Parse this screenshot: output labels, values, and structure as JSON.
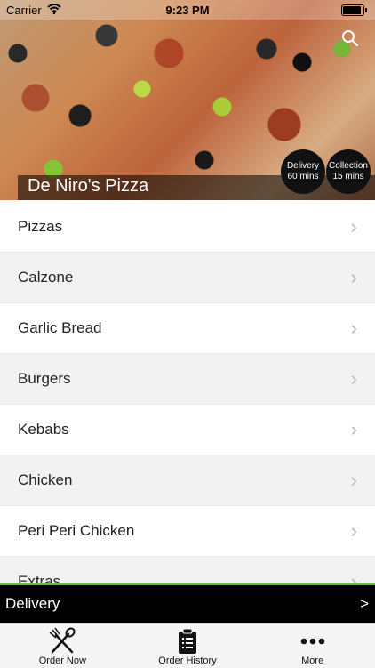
{
  "status_bar": {
    "carrier": "Carrier",
    "time": "9:23 PM"
  },
  "hero": {
    "restaurant_name": "De Niro's Pizza",
    "delivery_badge": {
      "title": "Delivery",
      "time": "60 mins"
    },
    "collection_badge": {
      "title": "Collection",
      "time": "15 mins"
    }
  },
  "menu": {
    "items": [
      {
        "label": "Pizzas"
      },
      {
        "label": "Calzone"
      },
      {
        "label": "Garlic Bread"
      },
      {
        "label": "Burgers"
      },
      {
        "label": "Kebabs"
      },
      {
        "label": "Chicken"
      },
      {
        "label": "Peri Peri Chicken"
      },
      {
        "label": "Extras"
      }
    ],
    "chevron": "›"
  },
  "order_mode_bar": {
    "label": "Delivery",
    "arrow": ">"
  },
  "tab_bar": {
    "tabs": [
      {
        "label": "Order Now",
        "icon": "fork-knife-icon"
      },
      {
        "label": "Order History",
        "icon": "clipboard-list-icon"
      },
      {
        "label": "More",
        "icon": "more-dots-icon"
      }
    ]
  },
  "colors": {
    "accent_green": "#6bbf3a",
    "bar_black": "#000000",
    "row_alt": "#f2f2f2"
  }
}
